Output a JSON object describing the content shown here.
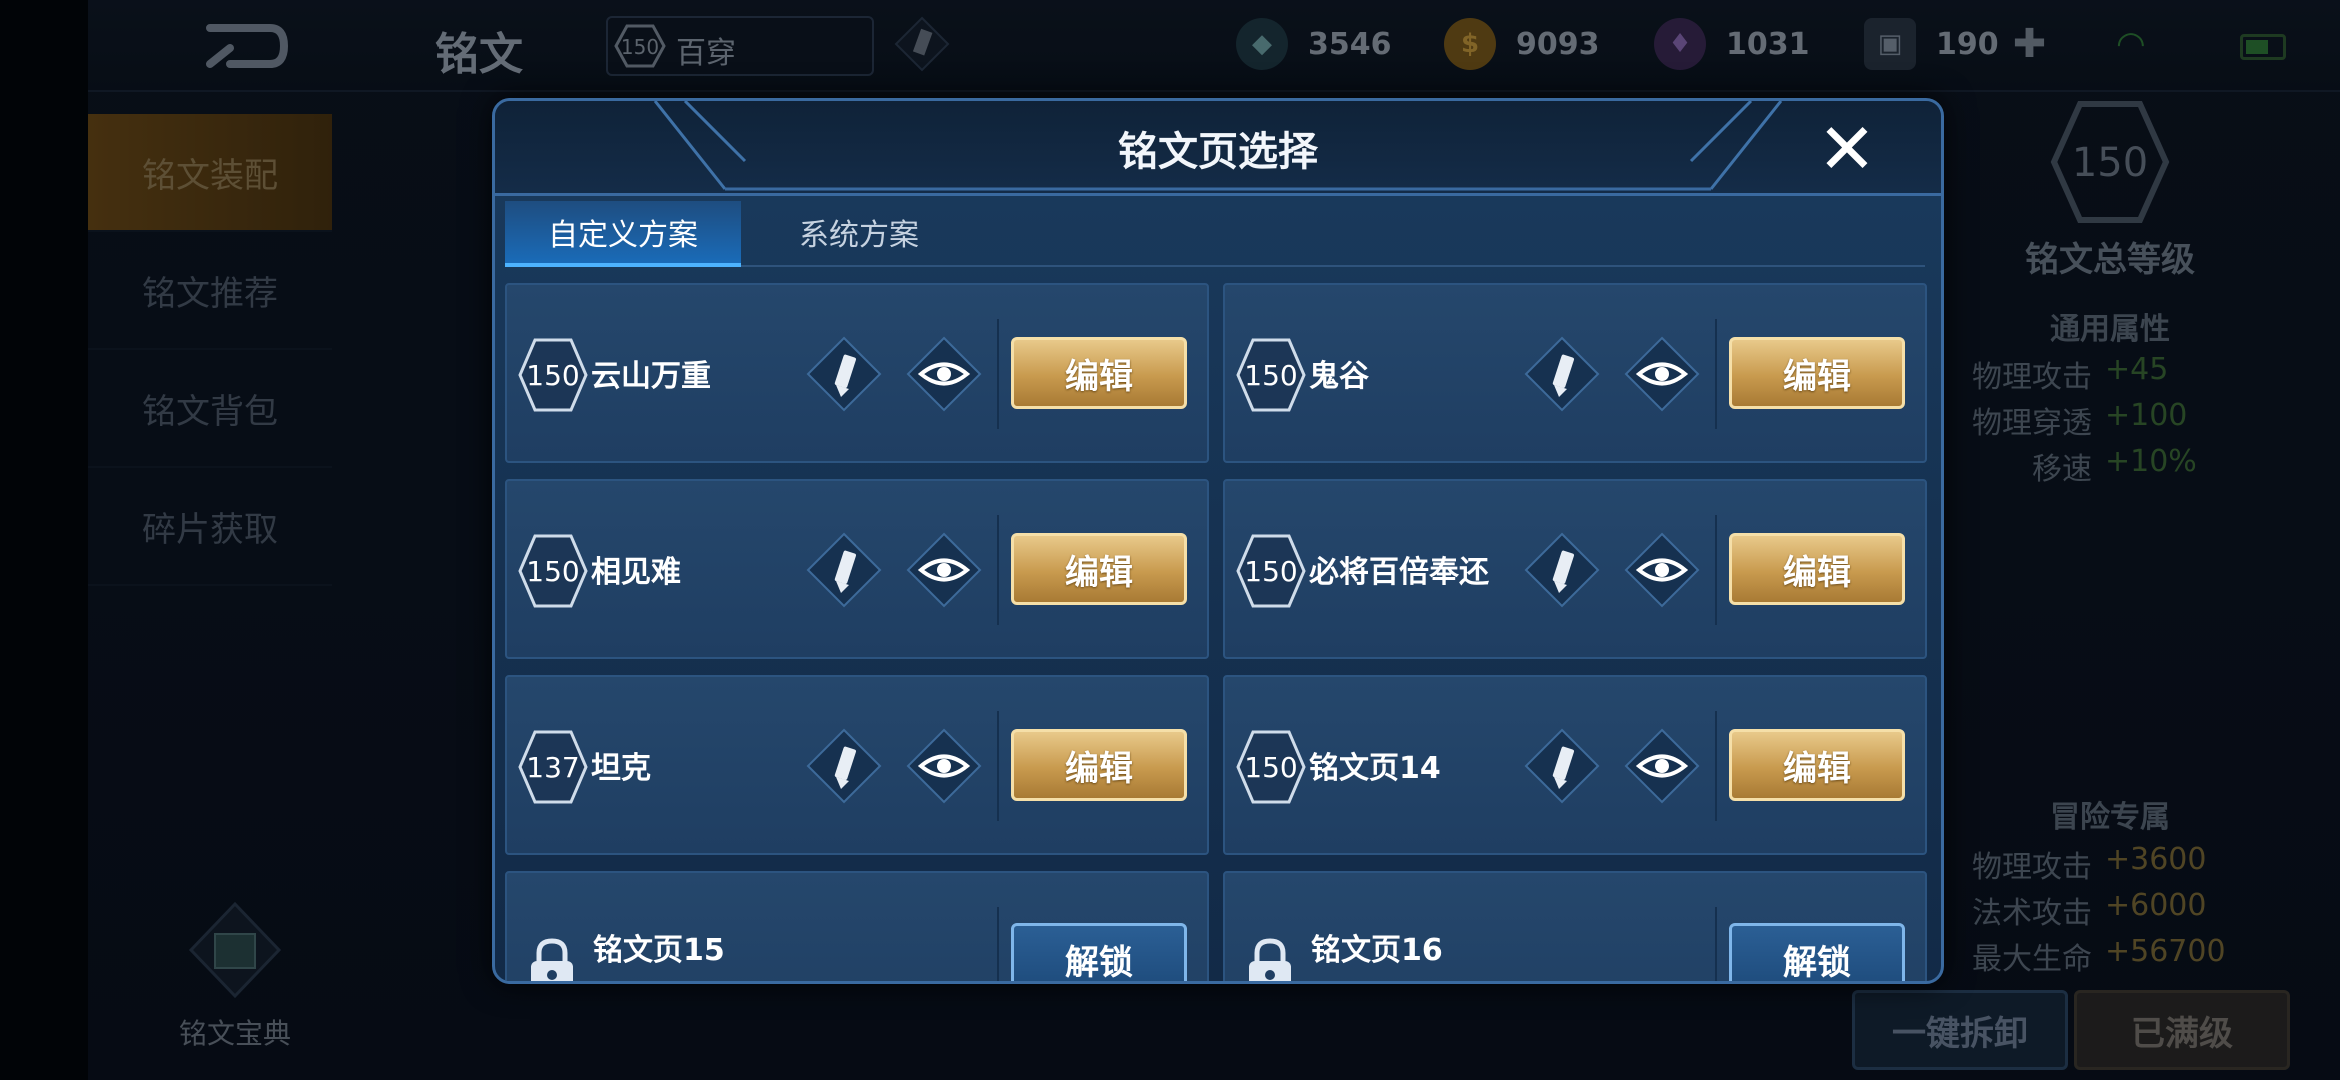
{
  "topbar": {
    "title": "铭文",
    "page_level": "150",
    "page_name": "百穿",
    "resources": [
      {
        "icon": "crystal-icon",
        "value": "3546"
      },
      {
        "icon": "gold-coin-icon",
        "value": "9093"
      },
      {
        "icon": "gem-icon",
        "value": "1031"
      },
      {
        "icon": "card-icon",
        "value": "190"
      }
    ]
  },
  "sidebar": {
    "items": [
      {
        "label": "铭文装配"
      },
      {
        "label": "铭文推荐"
      },
      {
        "label": "铭文背包"
      },
      {
        "label": "碎片获取"
      }
    ],
    "bible_label": "铭文宝典"
  },
  "right_panel": {
    "total_level": "150",
    "total_level_label": "铭文总等级",
    "general_title": "通用属性",
    "general_stats": [
      {
        "name": "物理攻击",
        "value": "+45"
      },
      {
        "name": "物理穿透",
        "value": "+100"
      },
      {
        "name": "移速",
        "value": "+10%"
      }
    ],
    "adventure_title": "冒险专属",
    "adventure_stats": [
      {
        "name": "物理攻击",
        "value": "+3600"
      },
      {
        "name": "法术攻击",
        "value": "+6000"
      },
      {
        "name": "最大生命",
        "value": "+56700"
      }
    ],
    "unload_button": "一键拆卸",
    "maxed_button": "已满级"
  },
  "modal": {
    "title": "铭文页选择",
    "tabs": [
      {
        "label": "自定义方案"
      },
      {
        "label": "系统方案"
      }
    ],
    "pages": [
      {
        "level": "150",
        "name": "云山万重",
        "button": "编辑"
      },
      {
        "level": "150",
        "name": "鬼谷",
        "button": "编辑"
      },
      {
        "level": "150",
        "name": "相见难",
        "button": "编辑"
      },
      {
        "level": "150",
        "name": "必将百倍奉还",
        "button": "编辑"
      },
      {
        "level": "137",
        "name": "坦克",
        "button": "编辑"
      },
      {
        "level": "150",
        "name": "铭文页14",
        "button": "编辑"
      }
    ],
    "locked_pages": [
      {
        "name": "铭文页15",
        "button": "解锁"
      },
      {
        "name": "铭文页16",
        "button": "解锁"
      }
    ]
  },
  "colors": {
    "accent_gold": "#c89a4e",
    "modal_bg": "#1a3b5e",
    "tab_active": "#1a6bb8",
    "stat_green": "#3d6b38"
  }
}
